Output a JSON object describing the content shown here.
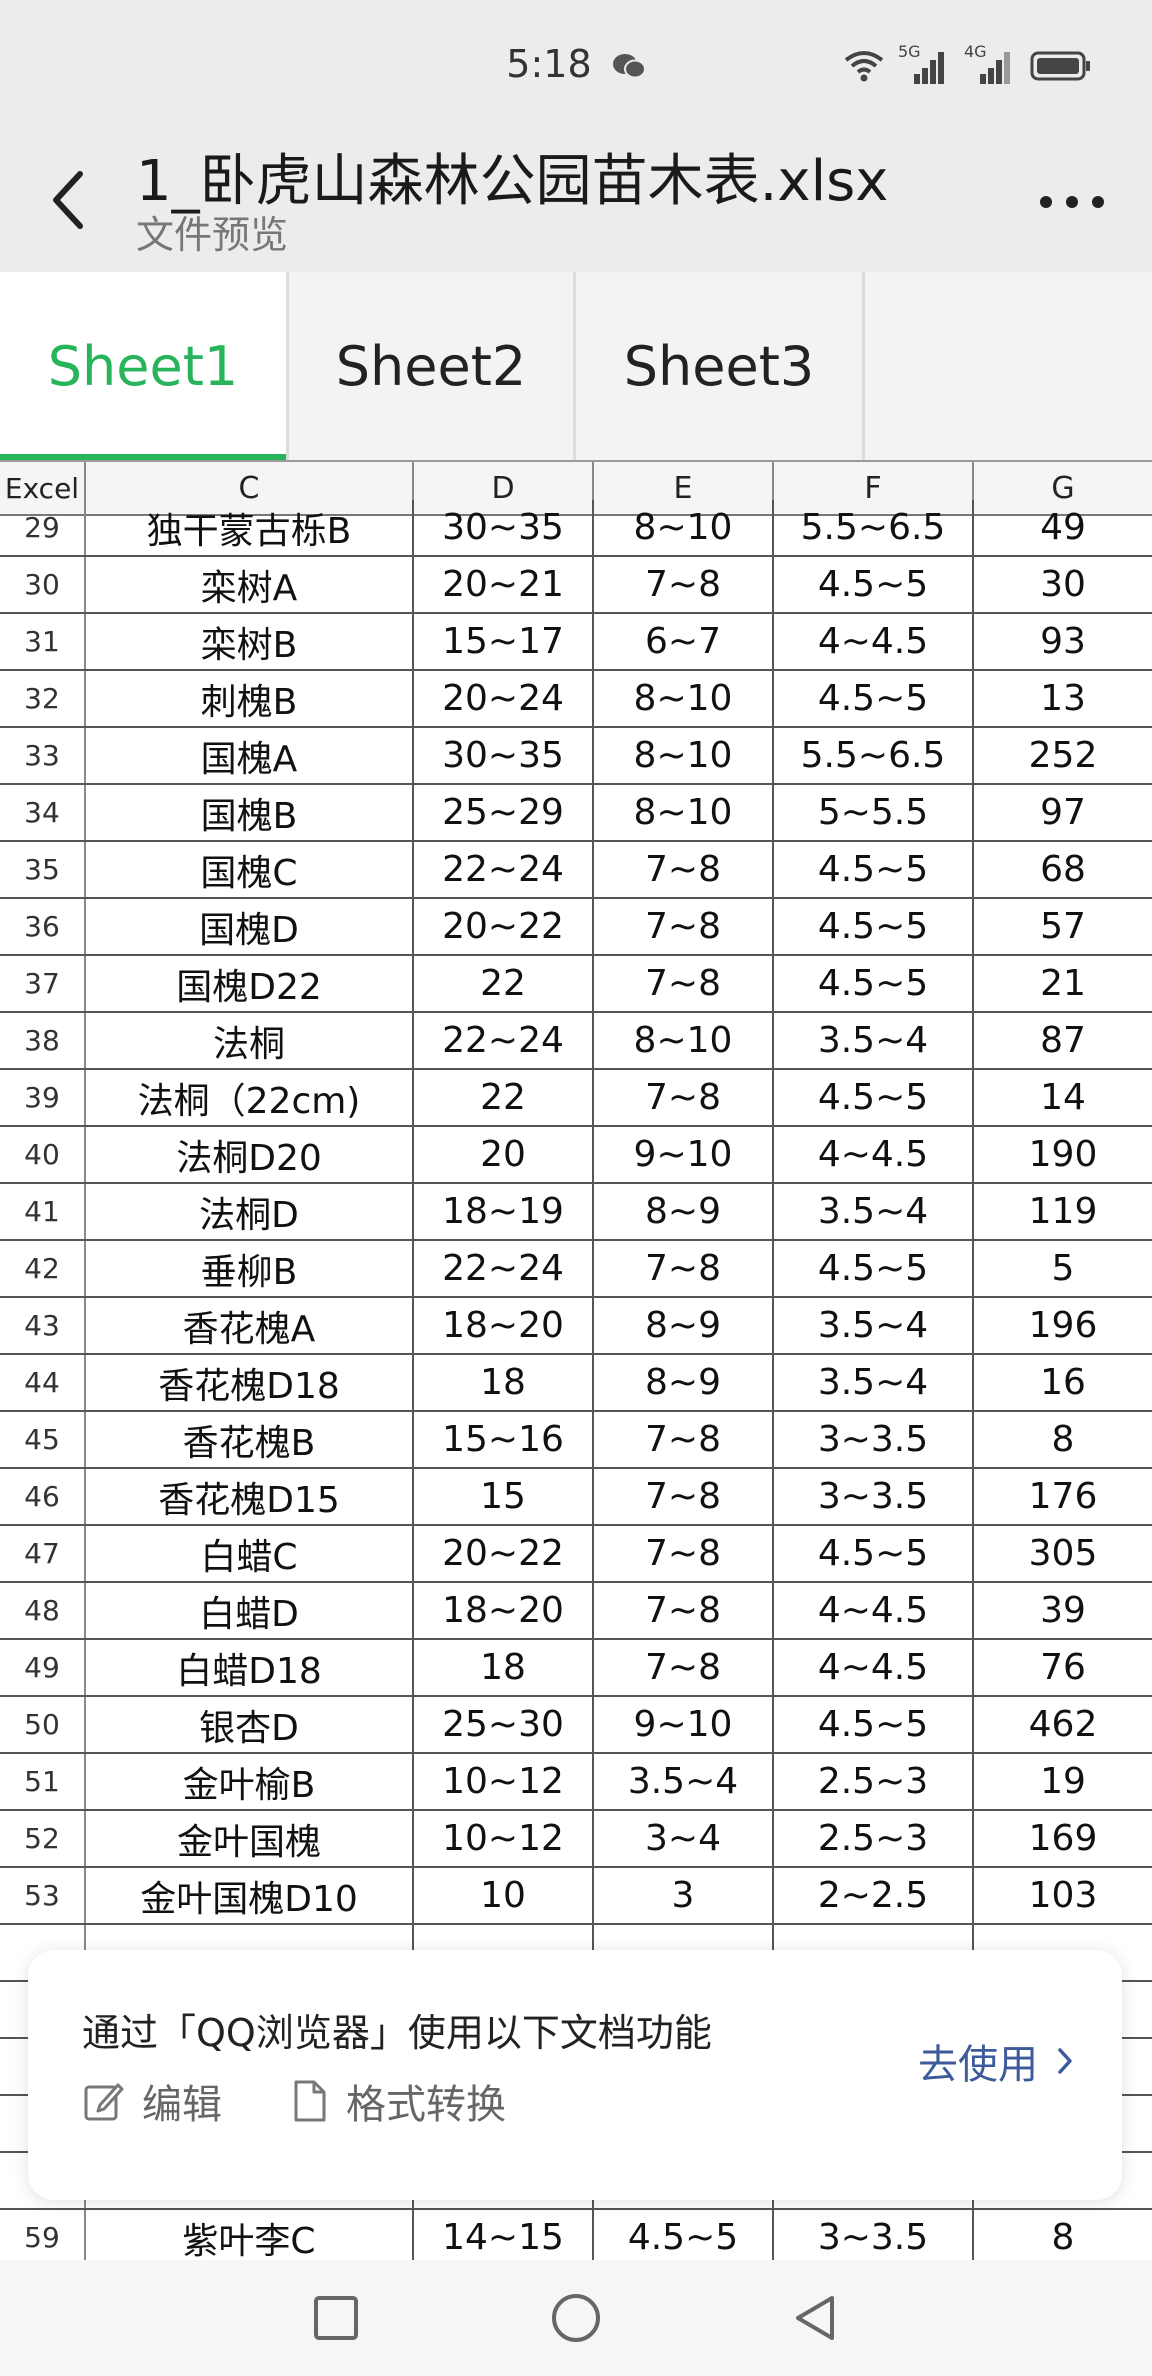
{
  "status_bar": {
    "time": "5:18",
    "net1": "5G",
    "net2": "4G"
  },
  "app_bar": {
    "title": "1_卧虎山森林公园苗木表.xlsx",
    "subtitle": "文件预览"
  },
  "tabs": [
    {
      "label": "Sheet1",
      "active": true
    },
    {
      "label": "Sheet2",
      "active": false
    },
    {
      "label": "Sheet3",
      "active": false
    }
  ],
  "grid": {
    "corner": "Excel",
    "columns": [
      "C",
      "D",
      "E",
      "F",
      "G"
    ],
    "rows": [
      {
        "n": "29",
        "c": "独干蒙古栎B",
        "d": "30~35",
        "e": "8~10",
        "f": "5.5~6.5",
        "g": "49"
      },
      {
        "n": "30",
        "c": "栾树A",
        "d": "20~21",
        "e": "7~8",
        "f": "4.5~5",
        "g": "30"
      },
      {
        "n": "31",
        "c": "栾树B",
        "d": "15~17",
        "e": "6~7",
        "f": "4~4.5",
        "g": "93"
      },
      {
        "n": "32",
        "c": "刺槐B",
        "d": "20~24",
        "e": "8~10",
        "f": "4.5~5",
        "g": "13"
      },
      {
        "n": "33",
        "c": "国槐A",
        "d": "30~35",
        "e": "8~10",
        "f": "5.5~6.5",
        "g": "252"
      },
      {
        "n": "34",
        "c": "国槐B",
        "d": "25~29",
        "e": "8~10",
        "f": "5~5.5",
        "g": "97"
      },
      {
        "n": "35",
        "c": "国槐C",
        "d": "22~24",
        "e": "7~8",
        "f": "4.5~5",
        "g": "68"
      },
      {
        "n": "36",
        "c": "国槐D",
        "d": "20~22",
        "e": "7~8",
        "f": "4.5~5",
        "g": "57"
      },
      {
        "n": "37",
        "c": "国槐D22",
        "d": "22",
        "e": "7~8",
        "f": "4.5~5",
        "g": "21"
      },
      {
        "n": "38",
        "c": "法桐",
        "d": "22~24",
        "e": "8~10",
        "f": "3.5~4",
        "g": "87"
      },
      {
        "n": "39",
        "c": "法桐（22cm)",
        "d": "22",
        "e": "7~8",
        "f": "4.5~5",
        "g": "14"
      },
      {
        "n": "40",
        "c": "法桐D20",
        "d": "20",
        "e": "9~10",
        "f": "4~4.5",
        "g": "190"
      },
      {
        "n": "41",
        "c": "法桐D",
        "d": "18~19",
        "e": "8~9",
        "f": "3.5~4",
        "g": "119"
      },
      {
        "n": "42",
        "c": "垂柳B",
        "d": "22~24",
        "e": "7~8",
        "f": "4.5~5",
        "g": "5"
      },
      {
        "n": "43",
        "c": "香花槐A",
        "d": "18~20",
        "e": "8~9",
        "f": "3.5~4",
        "g": "196"
      },
      {
        "n": "44",
        "c": "香花槐D18",
        "d": "18",
        "e": "8~9",
        "f": "3.5~4",
        "g": "16"
      },
      {
        "n": "45",
        "c": "香花槐B",
        "d": "15~16",
        "e": "7~8",
        "f": "3~3.5",
        "g": "8"
      },
      {
        "n": "46",
        "c": "香花槐D15",
        "d": "15",
        "e": "7~8",
        "f": "3~3.5",
        "g": "176"
      },
      {
        "n": "47",
        "c": "白蜡C",
        "d": "20~22",
        "e": "7~8",
        "f": "4.5~5",
        "g": "305"
      },
      {
        "n": "48",
        "c": "白蜡D",
        "d": "18~20",
        "e": "7~8",
        "f": "4~4.5",
        "g": "39"
      },
      {
        "n": "49",
        "c": "白蜡D18",
        "d": "18",
        "e": "7~8",
        "f": "4~4.5",
        "g": "76"
      },
      {
        "n": "50",
        "c": "银杏D",
        "d": "25~30",
        "e": "9~10",
        "f": "4.5~5",
        "g": "462"
      },
      {
        "n": "51",
        "c": "金叶榆B",
        "d": "10~12",
        "e": "3.5~4",
        "f": "2.5~3",
        "g": "19"
      },
      {
        "n": "52",
        "c": "金叶国槐",
        "d": "10~12",
        "e": "3~4",
        "f": "2.5~3",
        "g": "169"
      },
      {
        "n": "53",
        "c": "金叶国槐D10",
        "d": "10",
        "e": "3",
        "f": "2~2.5",
        "g": "103"
      }
    ],
    "bottom_row": {
      "n": "59",
      "c": "紫叶李C",
      "d": "14~15",
      "e": "4.5~5",
      "f": "3~3.5",
      "g": "8"
    }
  },
  "banner": {
    "text": "通过「QQ浏览器」使用以下文档功能",
    "edit_label": "编辑",
    "convert_label": "格式转换",
    "go_label": "去使用"
  },
  "colors": {
    "accent": "#27b45a",
    "link": "#3d5b9a"
  }
}
